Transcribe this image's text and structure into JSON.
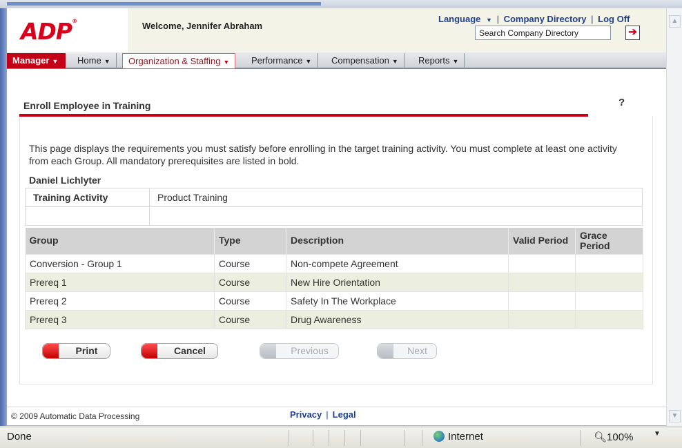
{
  "header": {
    "logo_text": "ADP",
    "welcome": "Welcome, Jennifer Abraham",
    "links": {
      "language": "Language",
      "company_directory": "Company Directory",
      "log_off": "Log Off",
      "separator": "|"
    },
    "search": {
      "value": "Search Company Directory"
    }
  },
  "nav": {
    "items": [
      {
        "label": "Manager"
      },
      {
        "label": "Home"
      },
      {
        "label": "Organization & Staffing"
      },
      {
        "label": "Performance"
      },
      {
        "label": "Compensation"
      },
      {
        "label": "Reports"
      }
    ]
  },
  "page": {
    "title": "Enroll Employee in Training",
    "help": "?",
    "intro": "This page displays the requirements you must satisfy before enrolling in the target training activity. You must complete at least one activity from each Group. All mandatory prerequisites are listed in bold.",
    "employee_name": "Daniel Lichlyter",
    "training_activity_label": "Training Activity",
    "training_activity_value": "Product Training"
  },
  "table": {
    "headers": {
      "group": "Group",
      "type": "Type",
      "description": "Description",
      "valid_period": "Valid Period",
      "grace_period": "Grace Period"
    },
    "rows": [
      {
        "group": "Conversion - Group 1",
        "type": "Course",
        "description": "Non-compete Agreement",
        "valid_period": "",
        "grace_period": ""
      },
      {
        "group": "Prereq 1",
        "type": "Course",
        "description": "New Hire Orientation",
        "valid_period": "",
        "grace_period": ""
      },
      {
        "group": "Prereq 2",
        "type": "Course",
        "description": "Safety In The Workplace",
        "valid_period": "",
        "grace_period": ""
      },
      {
        "group": "Prereq 3",
        "type": "Course",
        "description": "Drug Awareness",
        "valid_period": "",
        "grace_period": ""
      }
    ]
  },
  "buttons": {
    "print": "Print",
    "cancel": "Cancel",
    "previous": "Previous",
    "next": "Next"
  },
  "footer": {
    "copyright": "© 2009 Automatic Data Processing",
    "privacy": "Privacy",
    "legal": "Legal",
    "separator": "|"
  },
  "status_bar": {
    "status": "Done",
    "zone": "Internet",
    "zoom": "100%"
  },
  "colors": {
    "brand_red": "#c40016",
    "link_blue": "#1f3f8f",
    "alt_row": "#ecefdf"
  }
}
